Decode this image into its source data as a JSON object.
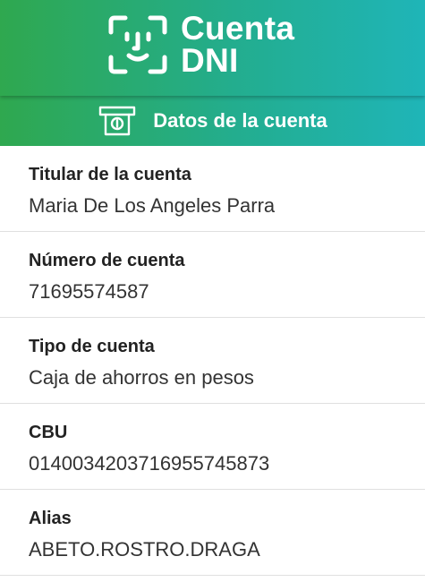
{
  "header": {
    "logo_line1": "Cuenta",
    "logo_line2": "DNI"
  },
  "subheader": {
    "title": "Datos de la cuenta",
    "icon": "atm-money-icon"
  },
  "account": [
    {
      "label": "Titular de la cuenta",
      "value": "Maria De Los Angeles Parra"
    },
    {
      "label": "Número de cuenta",
      "value": "71695574587"
    },
    {
      "label": "Tipo de cuenta",
      "value": "Caja de ahorros en pesos"
    },
    {
      "label": "CBU",
      "value": "0140034203716955745873"
    },
    {
      "label": "Alias",
      "value": "ABETO.ROSTRO.DRAGA"
    }
  ],
  "colors": {
    "gradient_start": "#2fa84f",
    "gradient_end": "#1fb5b8"
  }
}
